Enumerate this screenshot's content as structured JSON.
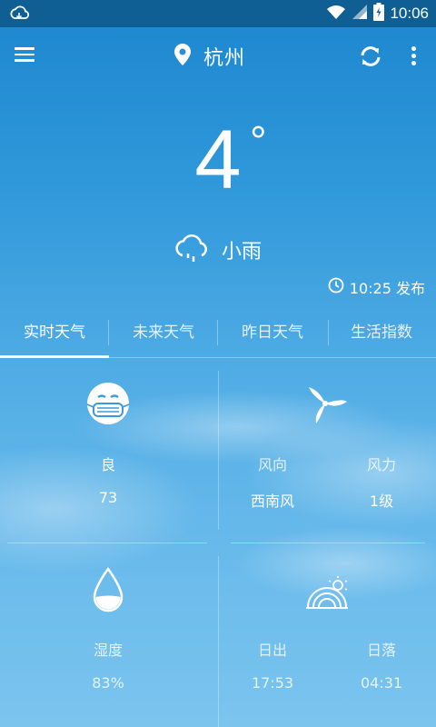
{
  "status_bar": {
    "time": "10:06"
  },
  "toolbar": {
    "city": "杭州"
  },
  "weather": {
    "temperature": "4",
    "unit": "°",
    "condition": "小雨",
    "publish_time": "10:25 发布"
  },
  "tabs": [
    {
      "label": "实时天气"
    },
    {
      "label": "未来天气"
    },
    {
      "label": "昨日天气"
    },
    {
      "label": "生活指数"
    }
  ],
  "air_quality": {
    "level": "良",
    "aqi": "73"
  },
  "wind": {
    "direction_label": "风向",
    "direction_value": "西南风",
    "force_label": "风力",
    "force_value": "1级"
  },
  "humidity": {
    "label": "湿度",
    "value": "83%"
  },
  "sun": {
    "sunrise_label": "日出",
    "sunrise_value": "17:53",
    "sunset_label": "日落",
    "sunset_value": "04:31"
  },
  "colors": {
    "status_bar": "#0f5f95",
    "sky_top": "#1c86cf",
    "sky_bottom": "#7bc4ee"
  }
}
